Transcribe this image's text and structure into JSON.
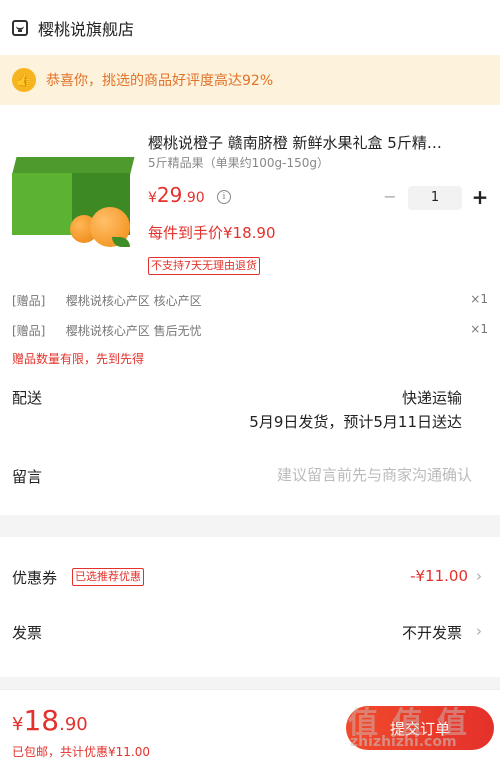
{
  "header": {
    "store_name": "樱桃说旗舰店",
    "icon": "store-icon"
  },
  "banner": {
    "icon": "thumbs-up-icon",
    "text": "恭喜你，挑选的商品好评度高达92%"
  },
  "product": {
    "title": "樱桃说橙子 赣南脐橙 新鲜水果礼盒 5斤精…",
    "spec": "5斤精品果（单果约100g-150g）",
    "price_symbol": "¥",
    "price_int": "29",
    "price_dec": ".90",
    "quantity": "1",
    "minus_label": "−",
    "plus_label": "+",
    "final_price": "每件到手价¥18.90",
    "no_return_tag": "不支持7天无理由退货"
  },
  "gifts": [
    {
      "tag": "[赠品]",
      "name": "樱桃说核心产区 核心产区",
      "qty": "×1"
    },
    {
      "tag": "[赠品]",
      "name": "樱桃说核心产区 售后无忧",
      "qty": "×1"
    }
  ],
  "gift_warning": "赠品数量有限，先到先得",
  "shipping": {
    "label": "配送",
    "method": "快递运输",
    "date": "5月9日发货，预计5月11日送达"
  },
  "message": {
    "label": "留言",
    "placeholder": "建议留言前先与商家沟通确认"
  },
  "coupon": {
    "label": "优惠券",
    "tag": "已选推荐优惠",
    "value": "-¥11.00",
    "chevron": "›"
  },
  "invoice": {
    "label": "发票",
    "value": "不开发票",
    "chevron": "›"
  },
  "bottom": {
    "price_symbol": "¥",
    "price_int": "18",
    "price_dec": ".90",
    "note": "已包邮，共计优惠¥11.00",
    "submit_label": "提交订单",
    "watermark": "值 值 值",
    "watermark_url": "zhizhizhi.com"
  },
  "colors": {
    "accent": "#e4312b",
    "banner_bg": "#fdf3dc",
    "banner_text": "#e1722a"
  }
}
